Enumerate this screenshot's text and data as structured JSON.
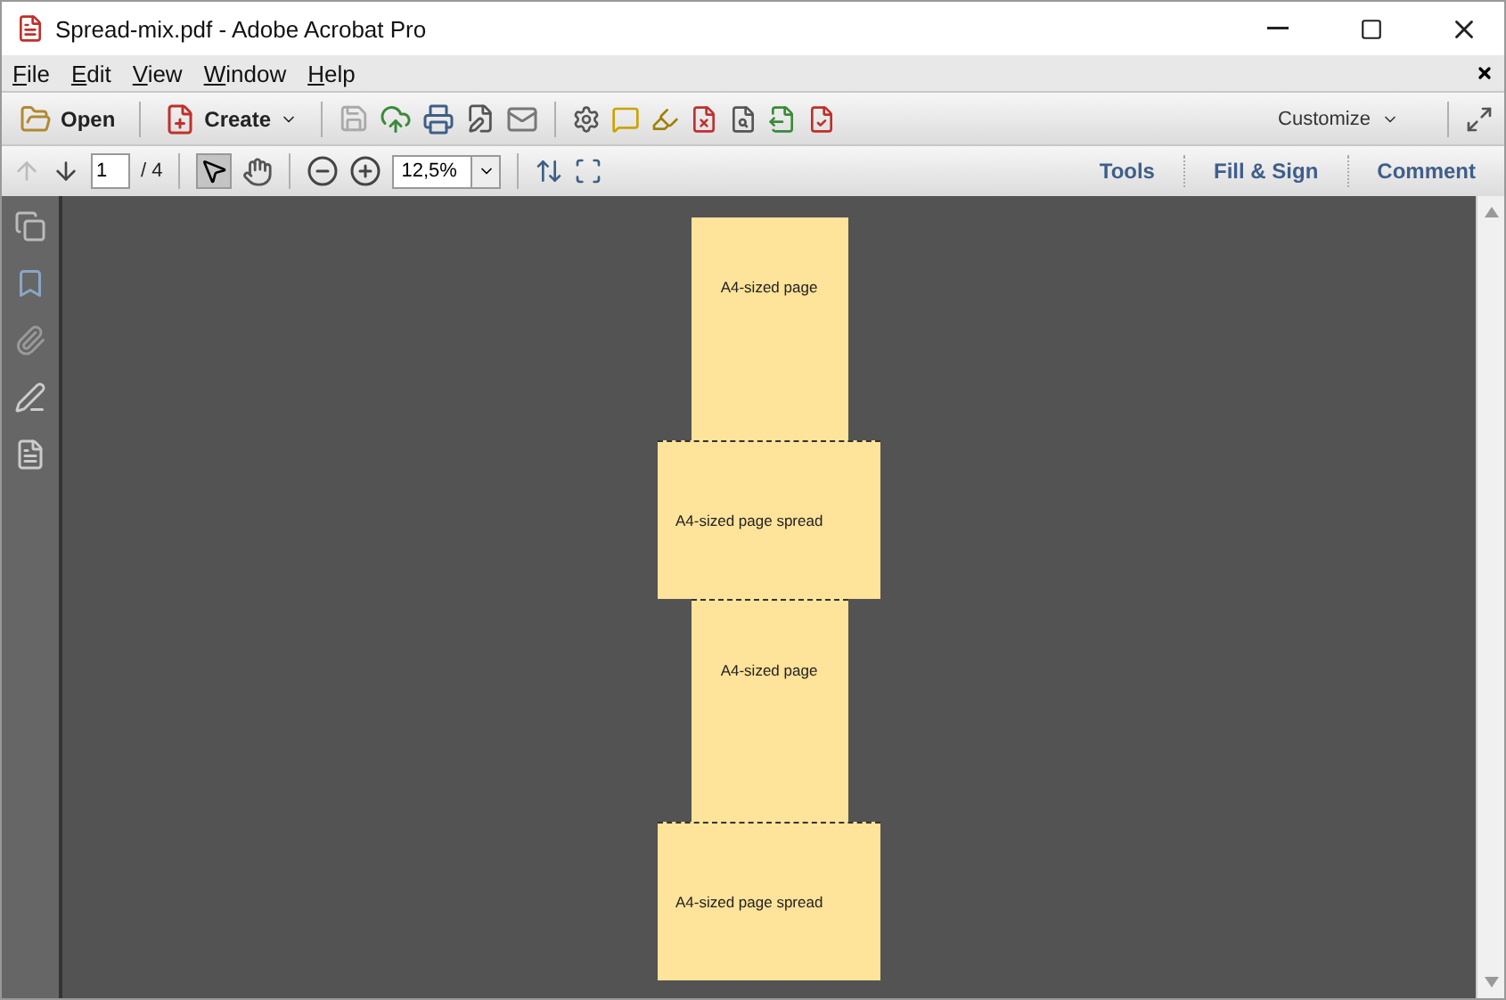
{
  "window": {
    "title": "Spread-mix.pdf - Adobe Acrobat Pro"
  },
  "menu": [
    "File",
    "Edit",
    "View",
    "Window",
    "Help"
  ],
  "toolbar": {
    "open": "Open",
    "create": "Create",
    "customize": "Customize"
  },
  "nav": {
    "page": "1",
    "total": "/ 4",
    "zoom": "12,5%"
  },
  "tool_tabs": [
    "Tools",
    "Fill & Sign",
    "Comment"
  ],
  "pages": [
    {
      "kind": "page",
      "label": "A4-sized page"
    },
    {
      "kind": "spread",
      "label": "A4-sized page spread"
    },
    {
      "kind": "page",
      "label": "A4-sized page"
    },
    {
      "kind": "spread",
      "label": "A4-sized page spread"
    }
  ]
}
